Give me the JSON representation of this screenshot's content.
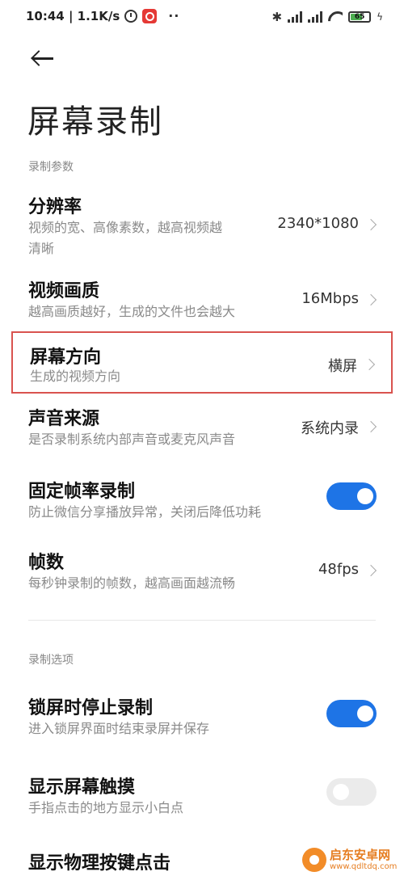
{
  "status_bar": {
    "time_speed": "10:44 | 1.1K/s",
    "dots": "··",
    "bluetooth": "✱",
    "battery_level": "65",
    "battery_fraction": 0.65,
    "icons": [
      "alarm-icon",
      "app-badge-icon",
      "bluetooth-icon",
      "signal-icon",
      "hd-signal-icon",
      "wifi-icon",
      "battery-icon",
      "charging-icon"
    ]
  },
  "page": {
    "title": "屏幕录制"
  },
  "sections": {
    "params_title": "录制参数",
    "options_title": "录制选项"
  },
  "settings": {
    "resolution": {
      "title": "分辨率",
      "subtitle": "视频的宽、高像素数，越高视频越清晰",
      "subtitle_line1": "视频的宽、高像素数，越高视频越",
      "subtitle_line2": "清晰",
      "value": "2340*1080"
    },
    "quality": {
      "title": "视频画质",
      "subtitle": "越高画质越好，生成的文件也会越大",
      "value": "16Mbps"
    },
    "orientation": {
      "title": "屏幕方向",
      "subtitle": "生成的视频方向",
      "value": "横屏"
    },
    "audio": {
      "title": "声音来源",
      "subtitle": "是否录制系统内部声音或麦克风声音",
      "value": "系统内录"
    },
    "fixed_fps": {
      "title": "固定帧率录制",
      "subtitle": "防止微信分享播放异常，关闭后降低功耗",
      "enabled": true
    },
    "fps": {
      "title": "帧数",
      "subtitle": "每秒钟录制的帧数，越高画面越流畅",
      "value": "48fps"
    },
    "lock_stop": {
      "title": "锁屏时停止录制",
      "subtitle": "进入锁屏界面时结束录屏并保存",
      "enabled": true
    },
    "show_touch": {
      "title": "显示屏幕触摸",
      "subtitle": "手指点击的地方显示小白点",
      "enabled": false
    },
    "show_keys": {
      "title": "显示物理按键点击"
    }
  },
  "colors": {
    "toggle_on": "#1e74e6",
    "toggle_off": "#ebebeb",
    "highlight_border": "#d9534f"
  },
  "watermark": {
    "name": "启东安卓网",
    "url": "www.qdltdq.com"
  }
}
